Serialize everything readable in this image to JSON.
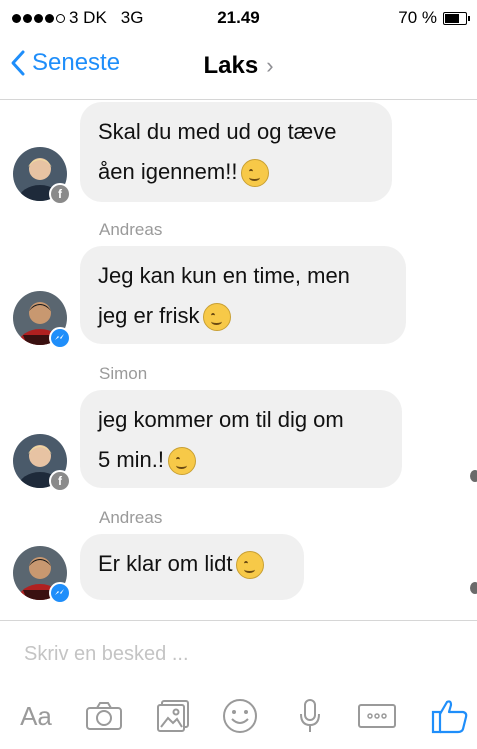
{
  "status_bar": {
    "carrier": "3 DK",
    "network": "3G",
    "time": "21.49",
    "battery": "70 %",
    "battery_level": 0.7
  },
  "nav": {
    "back_label": "Seneste",
    "title": "Laks",
    "back_icon": "chevron-left-icon",
    "title_chevron": "›"
  },
  "messages": [
    {
      "sender": "",
      "text": "Skal du med ud og tæve åen igennem!!",
      "line1": "Skal du med ud og tæve",
      "line2": "åen igennem!!",
      "avatar_badge": "facebook"
    },
    {
      "sender": "Andreas",
      "line1": "Jeg kan kun en time, men",
      "line2": "jeg er frisk",
      "avatar_badge": "messenger"
    },
    {
      "sender": "Simon",
      "line1": "jeg kommer om til dig om",
      "line2": "5 min.!",
      "avatar_badge": "facebook"
    },
    {
      "sender": "Andreas",
      "line1": "Er klar om lidt",
      "avatar_badge": "messenger"
    }
  ],
  "compose": {
    "placeholder": "Skriv en besked ..."
  },
  "toolbar": {
    "text_label": "Aa",
    "items": [
      "camera-icon",
      "gallery-icon",
      "emoji-icon",
      "microphone-icon",
      "more-icon",
      "like-icon"
    ]
  },
  "colors": {
    "accent": "#1f8efa",
    "bubble": "#f0f0f0",
    "muted": "#9a9a9a"
  }
}
